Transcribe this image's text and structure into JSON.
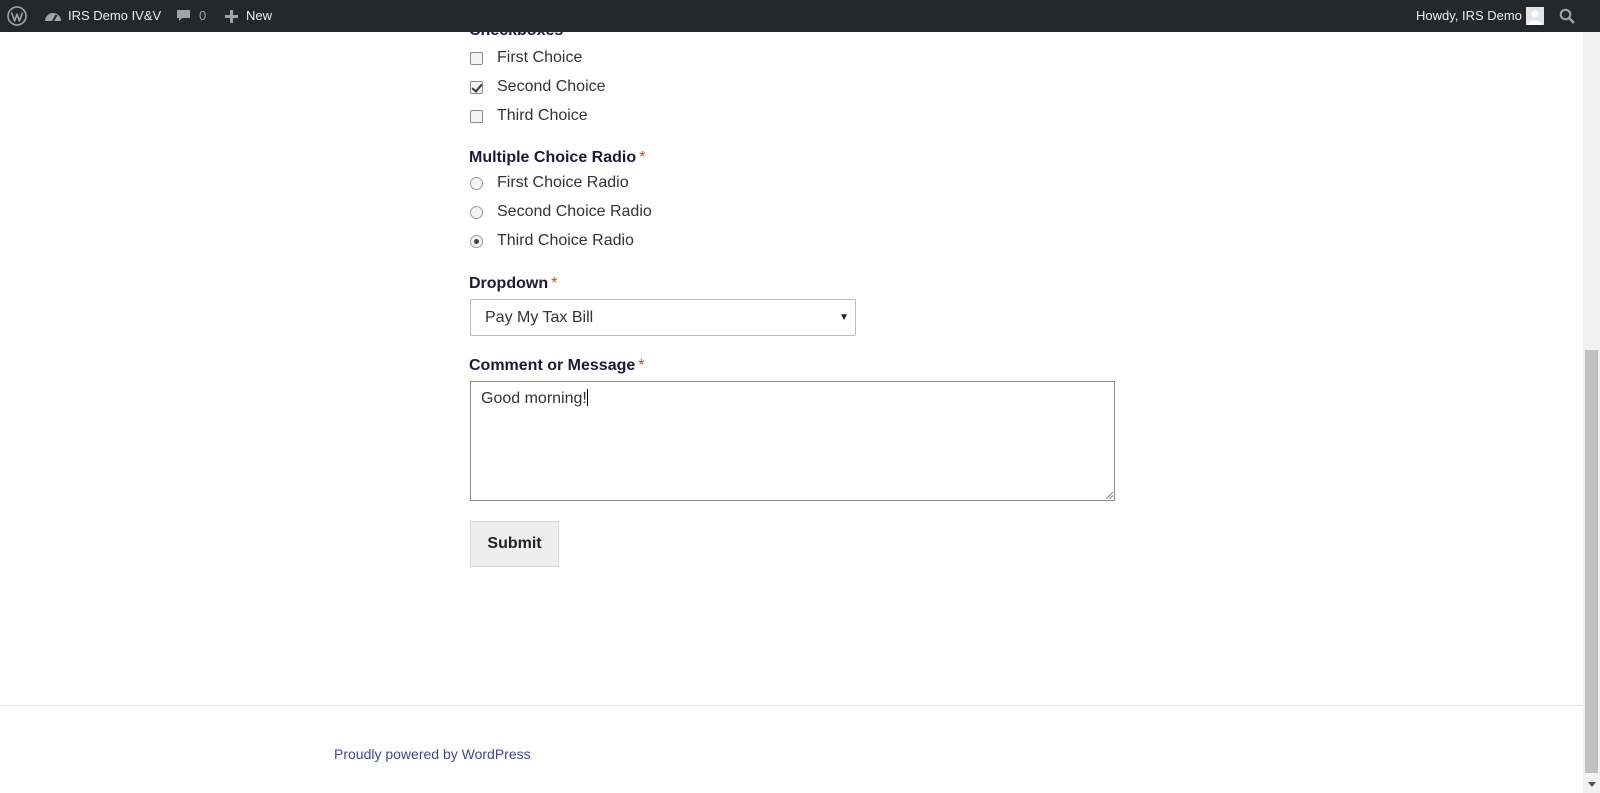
{
  "adminbar": {
    "site_name": "IRS Demo IV&V",
    "comment_count": "0",
    "new_label": "New",
    "howdy": "Howdy, IRS Demo"
  },
  "form": {
    "checkboxes": {
      "label": "Checkboxes",
      "options": [
        {
          "label": "First Choice",
          "checked": false
        },
        {
          "label": "Second Choice",
          "checked": true
        },
        {
          "label": "Third Choice",
          "checked": false
        }
      ]
    },
    "radio": {
      "label": "Multiple Choice Radio",
      "required_mark": "*",
      "options": [
        {
          "label": "First Choice Radio",
          "checked": false
        },
        {
          "label": "Second Choice Radio",
          "checked": false
        },
        {
          "label": "Third Choice Radio",
          "checked": true
        }
      ]
    },
    "dropdown": {
      "label": "Dropdown",
      "required_mark": "*",
      "selected": "Pay My Tax Bill"
    },
    "message": {
      "label": "Comment or Message",
      "required_mark": "*",
      "value": "Good morning!"
    },
    "submit_label": "Submit"
  },
  "footer": {
    "powered_by": "Proudly powered by WordPress"
  },
  "colors": {
    "adminbar_bg": "#23282d",
    "label_color": "#1a1a3a",
    "required_color": "#e2401c",
    "link_color": "#45458a"
  }
}
